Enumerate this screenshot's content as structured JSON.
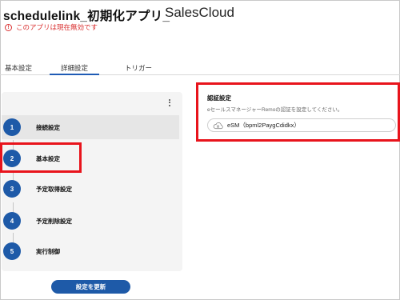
{
  "header": {
    "title": "schedulelink_初期化アプリ_",
    "app_name": "SalesCloud",
    "warning_icon": "!",
    "warning": "このアプリは現在無効です"
  },
  "tabs": [
    {
      "label": "基本設定",
      "active": false
    },
    {
      "label": "詳細設定",
      "active": true
    },
    {
      "label": "トリガー",
      "active": false
    }
  ],
  "steps": [
    {
      "number": "1",
      "label": "接続設定",
      "selected": true
    },
    {
      "number": "2",
      "label": "基本設定",
      "selected": false
    },
    {
      "number": "3",
      "label": "予定取得設定",
      "selected": false
    },
    {
      "number": "4",
      "label": "予定削除設定",
      "selected": false
    },
    {
      "number": "5",
      "label": "実行制御",
      "selected": false
    }
  ],
  "actions": {
    "update_label": "設定を更新"
  },
  "auth": {
    "title": "認証設定",
    "description": "eセールスマネージャーRemoの認証を設定してください。",
    "selected_value": "eSM（bpml2PaygCdidkx）"
  },
  "colors": {
    "accent": "#1e5aa8",
    "highlight": "#e8141c",
    "warning": "#d93030"
  },
  "icons": {
    "menu": "kebab-menu-icon",
    "auth_value": "cloud-icon"
  }
}
